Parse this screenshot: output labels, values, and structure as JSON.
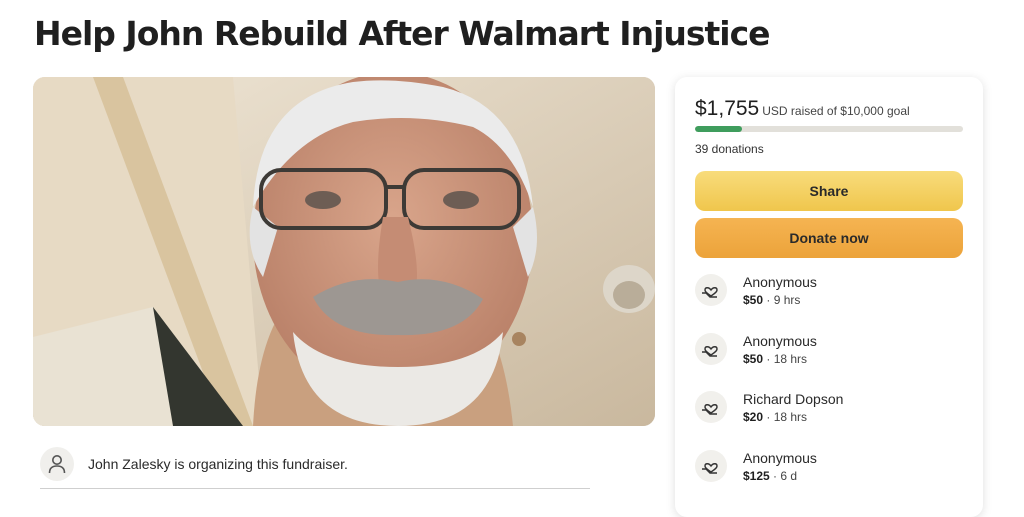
{
  "page": {
    "title": "Help John Rebuild After Walmart Injustice"
  },
  "hero": {
    "image_icon": "organizer-photo"
  },
  "organizer": {
    "text": "John Zalesky is organizing this fundraiser.",
    "icon": "user-icon"
  },
  "donation_card": {
    "raised_amount": "$1,755",
    "raised_suffix": "USD raised of $10,000 goal",
    "progress_fraction": 0.1755,
    "donation_count": "39 donations",
    "share_label": "Share",
    "donate_label": "Donate now",
    "share_color": "#f3ce5e",
    "donate_color": "#eeab45",
    "progress_color": "#3f9d5d"
  },
  "donations": [
    {
      "name": "Anonymous",
      "amount": "$50",
      "time": "9 hrs"
    },
    {
      "name": "Anonymous",
      "amount": "$50",
      "time": "18 hrs"
    },
    {
      "name": "Richard Dopson",
      "amount": "$20",
      "time": "18 hrs"
    },
    {
      "name": "Anonymous",
      "amount": "$125",
      "time": "6 d"
    }
  ]
}
